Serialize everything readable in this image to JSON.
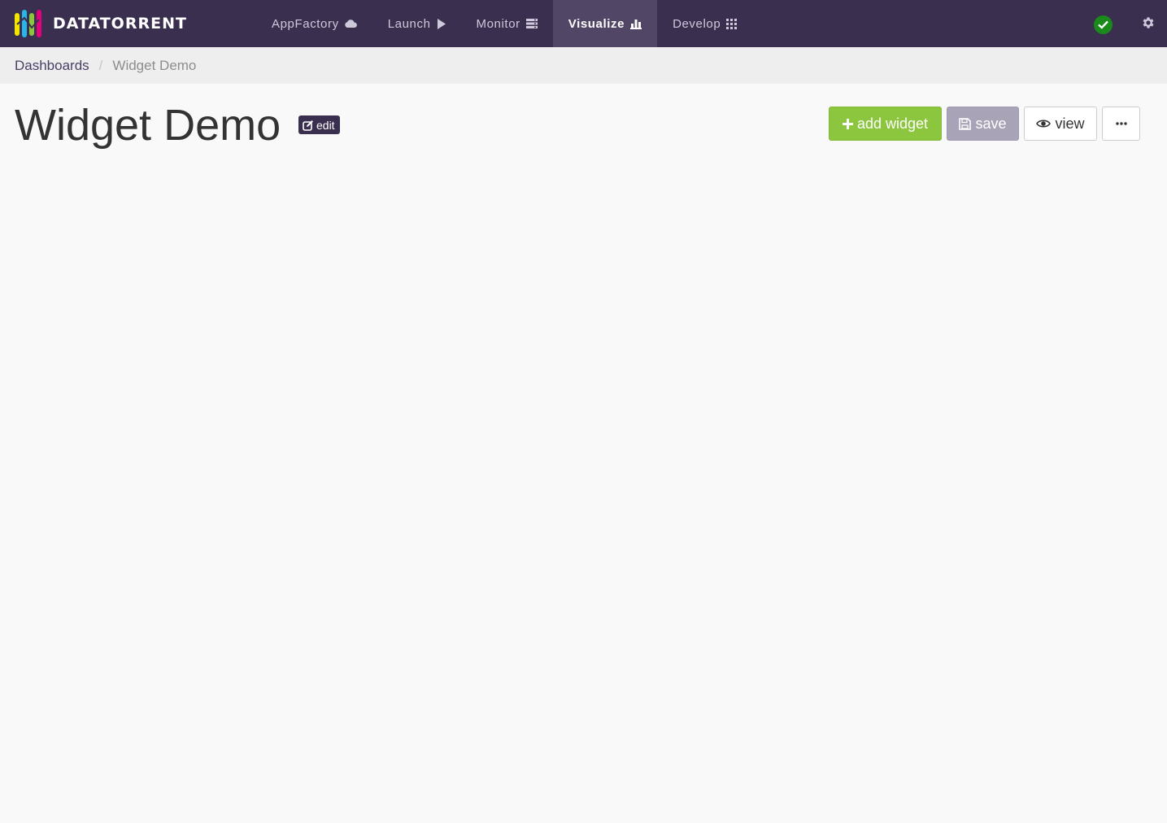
{
  "brand": {
    "name": "DATATORRENT",
    "logo_colors": [
      "#f2e600",
      "#27b6e8",
      "#8cc63f",
      "#e6007e"
    ]
  },
  "nav": {
    "items": [
      {
        "label": "AppFactory",
        "icon": "cloud-icon",
        "active": false
      },
      {
        "label": "Launch",
        "icon": "play-icon",
        "active": false
      },
      {
        "label": "Monitor",
        "icon": "server-icon",
        "active": false
      },
      {
        "label": "Visualize",
        "icon": "bar-chart-icon",
        "active": true
      },
      {
        "label": "Develop",
        "icon": "grid-icon",
        "active": false
      }
    ],
    "status_icon": "check-circle-icon",
    "settings_icon": "gear-icon"
  },
  "breadcrumb": {
    "parent": "Dashboards",
    "separator": "/",
    "current": "Widget Demo"
  },
  "page": {
    "title": "Widget Demo",
    "edit_label": "edit"
  },
  "toolbar": {
    "add_widget_label": "add widget",
    "save_label": "save",
    "view_label": "view",
    "more_label": "···"
  },
  "colors": {
    "navbar": "#3b2f4f",
    "accent_green": "#8cc63f",
    "save_disabled": "#a8a3b6",
    "status_ok": "#1a8a1a"
  }
}
